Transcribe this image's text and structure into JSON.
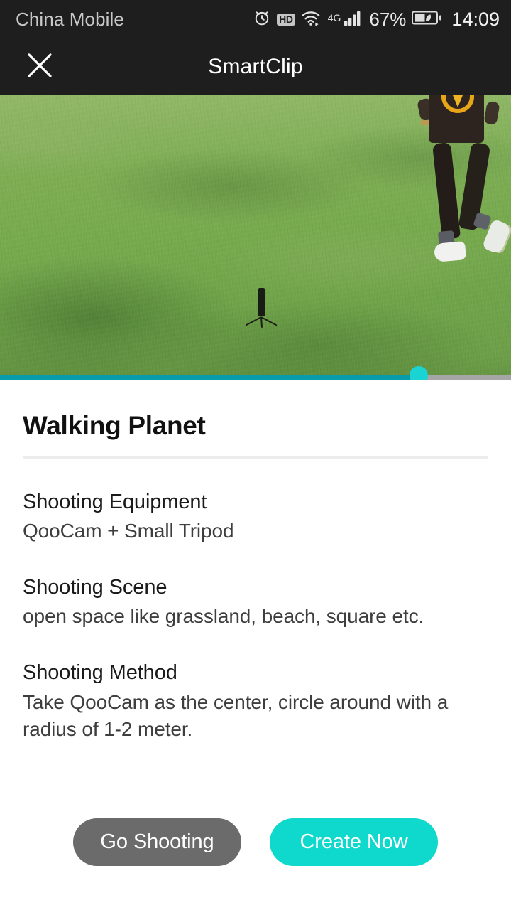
{
  "status_bar": {
    "carrier": "China Mobile",
    "battery_percent": "67%",
    "clock": "14:09",
    "network_generation": "4G",
    "hd_label": "HD",
    "icons": [
      "alarm-clock-icon",
      "hd-icon",
      "wifi-icon",
      "cellular-signal-icon",
      "battery-icon"
    ]
  },
  "header": {
    "title": "SmartClip",
    "close_label": "Close"
  },
  "preview": {
    "scene_description": "person walking on a grass field beside a camera on a small tripod",
    "seek": {
      "progress_percent": 82,
      "fill_color": "#089bab",
      "track_color": "#a6a6a6",
      "thumb_color": "#1ad4d4"
    }
  },
  "card": {
    "title": "Walking Planet",
    "sections": [
      {
        "heading": "Shooting Equipment",
        "body": "QooCam + Small Tripod"
      },
      {
        "heading": "Shooting Scene",
        "body": "open space like grassland, beach, square etc."
      },
      {
        "heading": "Shooting Method",
        "body": "Take QooCam as the center, circle around with a radius of 1-2 meter."
      }
    ]
  },
  "actions": {
    "secondary_label": "Go Shooting",
    "primary_label": "Create Now",
    "secondary_color": "#6b6b6b",
    "primary_color": "#0fd9cc"
  }
}
